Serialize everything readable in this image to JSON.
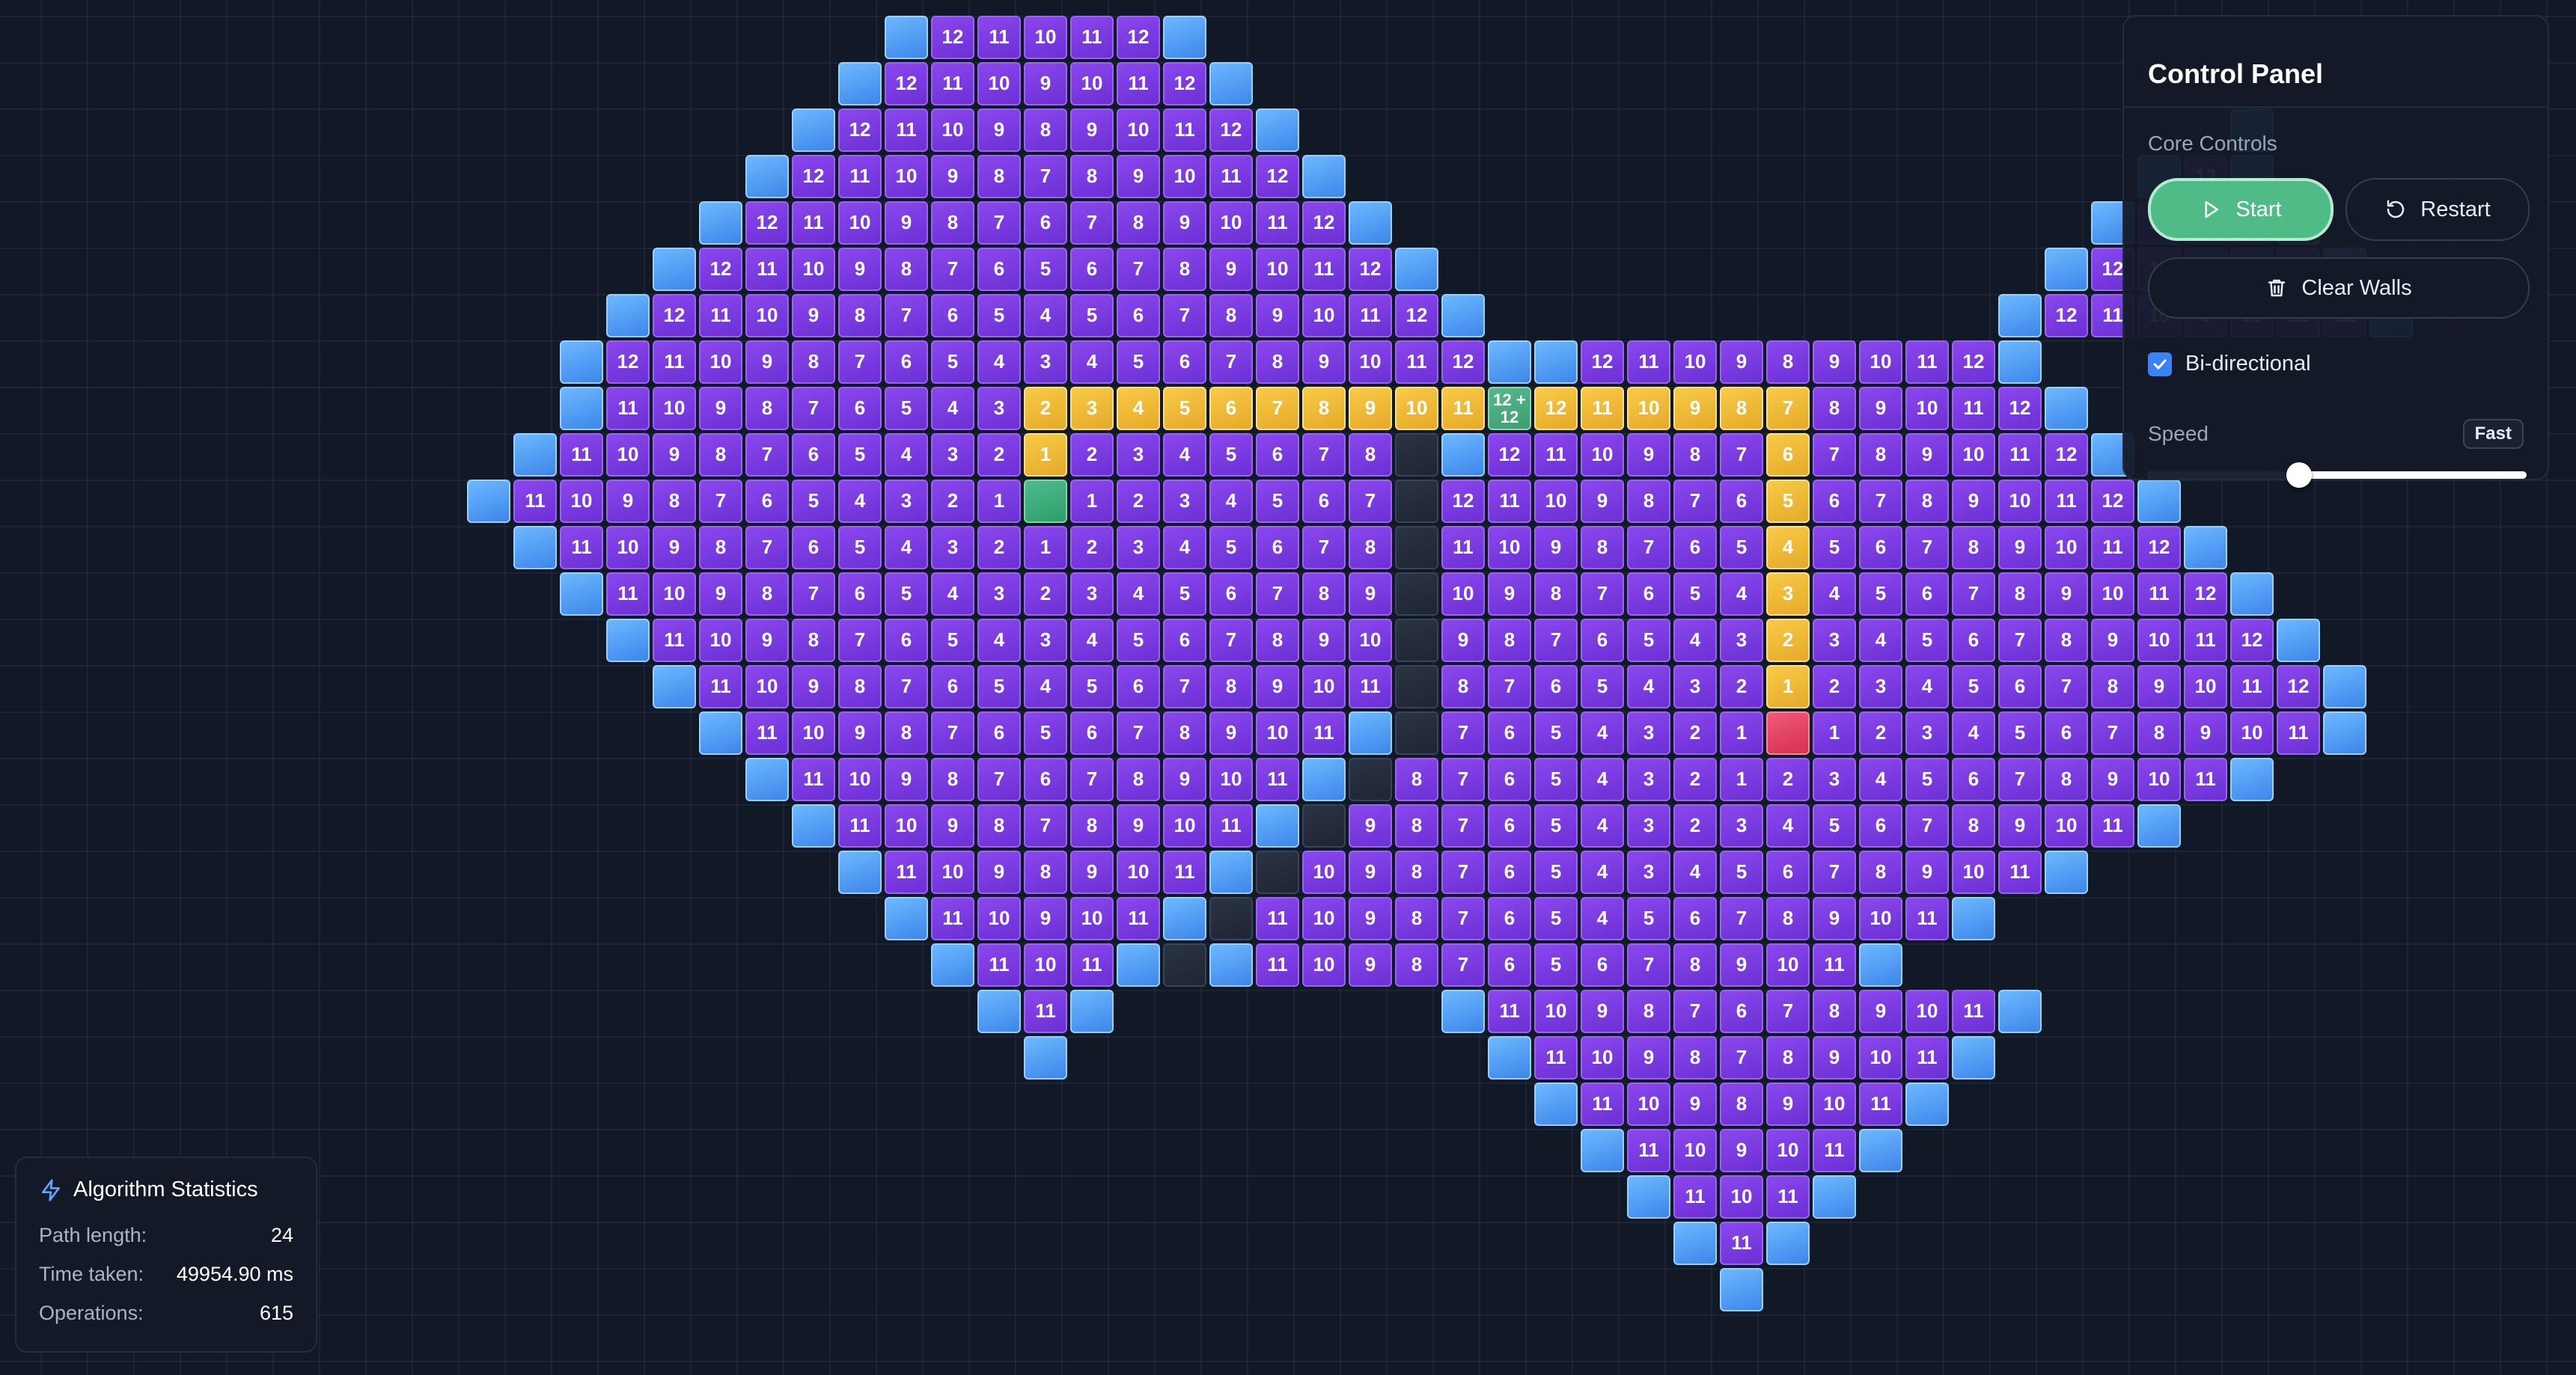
{
  "control_panel": {
    "title": "Control Panel",
    "section_label": "Core Controls",
    "start_label": "Start",
    "restart_label": "Restart",
    "clear_walls_label": "Clear Walls",
    "bidirectional_label": "Bi-directional",
    "bidirectional_checked": true,
    "speed_label": "Speed",
    "speed_value_label": "Fast",
    "speed_slider_fraction": 0.4,
    "icons": {
      "start": "play-icon",
      "restart": "restart-icon",
      "clear_walls": "trash-icon",
      "bidirectional": "checkbox-checked-icon"
    }
  },
  "stats": {
    "title": "Algorithm Statistics",
    "title_icon": "lightning-icon",
    "path_length_label": "Path length:",
    "path_length_value": "24",
    "time_taken_label": "Time taken:",
    "time_taken_value": "49954.90 ms",
    "operations_label": "Operations:",
    "operations_value": "615"
  },
  "legend_colors": {
    "visited": "#7c3aed",
    "frontier": "#60a5fa",
    "path": "#f5c242",
    "start": "#4cb886",
    "target": "#e8445f",
    "wall": "#252d3b",
    "background": "#111826"
  },
  "grid": {
    "rows": [
      "..............F12 11 10 11 12F",
      ".............F12 11 10 9 10 11 12F",
      "............F12 11 10 9 8 9 10 11 12F....................F",
      "...........F12 11 10 9 8 7 8 9 10 11 12F.................F12F",
      "..........F12 11 10 9 8 7 6 7 8 9 10 11 12F...............F12 11 12F",
      ".........F12 11 10 9 8 7 6 5 6 7 8 9 10 11 12F.............F12 11 10 11 12F",
      "........F12 11 10 9 8 7 6 5 4 5 6 7 8 9 10 11 12F...........F12 11 10 9 10 11 12F",
      ".......F12 11 10 9 8 7 6 5 4 3 4 5 6 7 8 9 10 11 12FF12 11 10 9 8 9 10 11 12F",
      ".......F11 10 9 8 7 6 5 4 3 P2 P3 P4 P5 P6 P7 P8 P9 P10 P11 M12+12 P12 P11 P10 P9 P8 P7 8 9 10 11 12F",
      "......F11 10 9 8 7 6 5 4 3 2 P1 2 3 4 5 6 7 8WF12 11 10 9 8 7 P6 7 8 9 10 11 12F",
      ".....F11 10 9 8 7 6 5 4 3 2 1S1 2 3 4 5 6 7W12 11 10 9 8 7 6 P5 6 7 8 9 10 11 12F",
      "......F11 10 9 8 7 6 5 4 3 2 1 2 3 4 5 6 7 8W11 10 9 8 7 6 5 P4 5 6 7 8 9 10 11 12F",
      ".......F11 10 9 8 7 6 5 4 3 2 3 4 5 6 7 8 9W10 9 8 7 6 5 4 P3 4 5 6 7 8 9 10 11 12F",
      "........F11 10 9 8 7 6 5 4 3 4 5 6 7 8 9 10W9 8 7 6 5 4 3 P2 3 4 5 6 7 8 9 10 11 12F",
      ".........F11 10 9 8 7 6 5 4 5 6 7 8 9 10 11W8 7 6 5 4 3 2 P1 2 3 4 5 6 7 8 9 10 11 12F",
      "..........F11 10 9 8 7 6 5 6 7 8 9 10 11FW7 6 5 4 3 2 1T1 2 3 4 5 6 7 8 9 10 11F",
      "...........F11 10 9 8 7 6 7 8 9 10 11FW8 7 6 5 4 3 2 1 2 3 4 5 6 7 8 9 10 11F",
      "............F11 10 9 8 7 8 9 10 11FW9 8 7 6 5 4 3 2 3 4 5 6 7 8 9 10 11F",
      ".............F11 10 9 8 9 10 11FW10 9 8 7 6 5 4 3 4 5 6 7 8 9 10 11F",
      "..............F11 10 9 10 11FW11 10 9 8 7 6 5 4 5 6 7 8 9 10 11F",
      "...............F11 10 11FWF11 10 9 8 7 6 5 6 7 8 9 10 11F",
      "................F11F.......F11 10 9 8 7 6 7 8 9 10 11F",
      ".................F.........F11 10 9 8 7 8 9 10 11F",
      "............................F11 10 9 8 9 10 11F",
      ".............................F11 10 9 10 11F",
      "..............................F11 10 11F",
      "...............................F11F",
      "................................F"
    ]
  }
}
